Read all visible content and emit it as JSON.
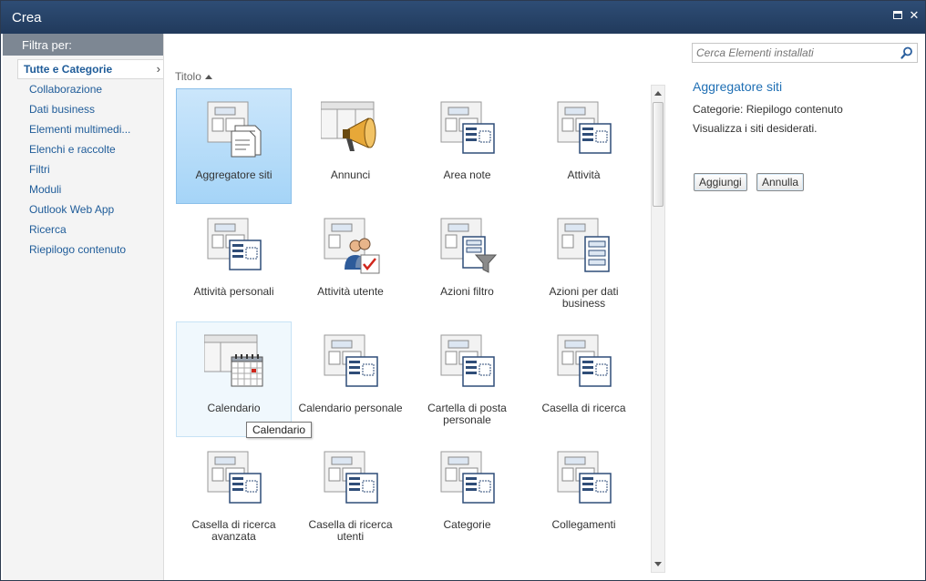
{
  "window": {
    "title": "Crea"
  },
  "sidebar": {
    "header": "Filtra per:",
    "items": [
      {
        "label": "Tutte e Categorie",
        "selected": true
      },
      {
        "label": "Collaborazione"
      },
      {
        "label": "Dati business"
      },
      {
        "label": "Elementi multimedi..."
      },
      {
        "label": "Elenchi e raccolte"
      },
      {
        "label": "Filtri"
      },
      {
        "label": "Moduli"
      },
      {
        "label": "Outlook Web App"
      },
      {
        "label": "Ricerca"
      },
      {
        "label": "Riepilogo contenuto"
      }
    ]
  },
  "main": {
    "sort_label": "Titolo",
    "tiles": [
      {
        "label": "Aggregatore siti",
        "icon": "site-aggregator-icon"
      },
      {
        "label": "Annunci",
        "icon": "announcements-icon"
      },
      {
        "label": "Area note",
        "icon": "webpart-icon"
      },
      {
        "label": "Attività",
        "icon": "webpart-icon"
      },
      {
        "label": "Attività personali",
        "icon": "webpart-icon"
      },
      {
        "label": "Attività utente",
        "icon": "user-tasks-icon"
      },
      {
        "label": "Azioni filtro",
        "icon": "filter-actions-icon"
      },
      {
        "label": "Azioni per dati business",
        "icon": "business-data-icon"
      },
      {
        "label": "Calendario",
        "icon": "calendar-icon"
      },
      {
        "label": "Calendario personale",
        "icon": "webpart-icon"
      },
      {
        "label": "Cartella di posta personale",
        "icon": "webpart-icon"
      },
      {
        "label": "Casella di ricerca",
        "icon": "webpart-icon"
      },
      {
        "label": "Casella di ricerca avanzata",
        "icon": "webpart-icon"
      },
      {
        "label": "Casella di ricerca utenti",
        "icon": "webpart-icon"
      },
      {
        "label": "Categorie",
        "icon": "webpart-icon"
      },
      {
        "label": "Collegamenti",
        "icon": "webpart-icon"
      }
    ],
    "tooltip": "Calendario"
  },
  "details": {
    "search_placeholder": "Cerca Elementi installati",
    "title": "Aggregatore siti",
    "category": "Categorie: Riepilogo contenuto",
    "description": "Visualizza i siti desiderati.",
    "add_label": "Aggiungi",
    "cancel_label": "Annulla"
  }
}
